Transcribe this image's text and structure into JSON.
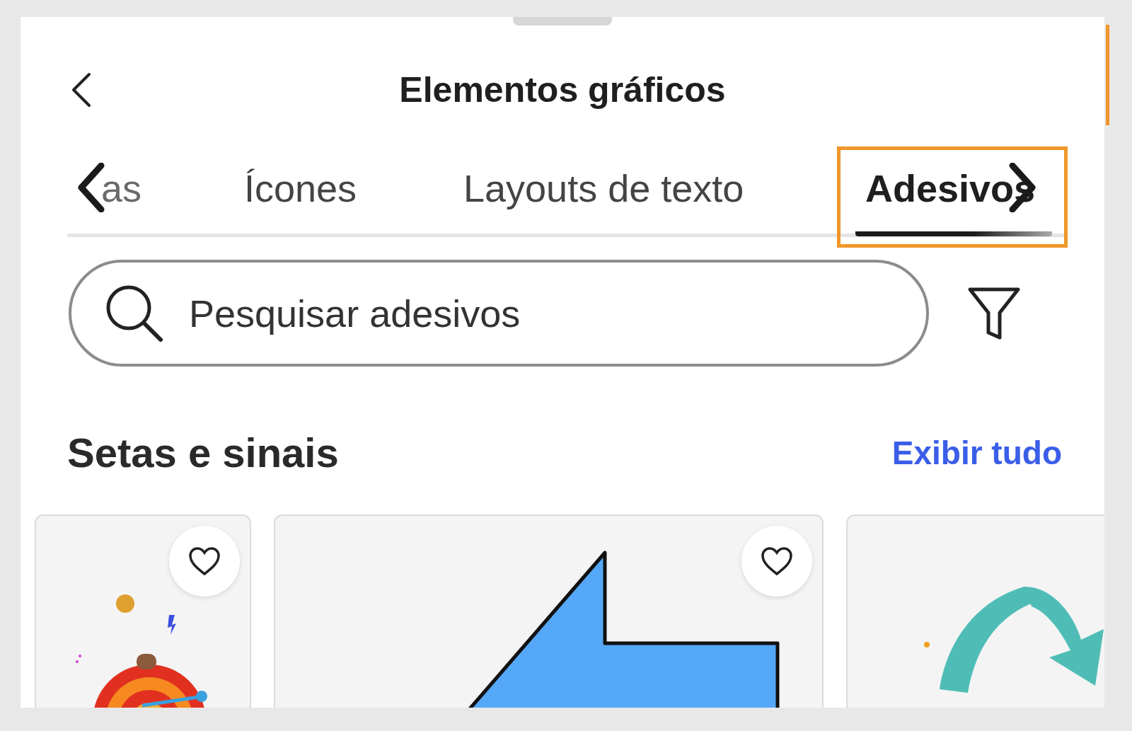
{
  "header": {
    "title": "Elementos gráficos"
  },
  "tabs": [
    {
      "label": "as",
      "selected": false
    },
    {
      "label": "Ícones",
      "selected": false
    },
    {
      "label": "Layouts de texto",
      "selected": false
    },
    {
      "label": "Adesivos",
      "selected": true
    }
  ],
  "search": {
    "placeholder": "Pesquisar adesivos"
  },
  "section": {
    "title": "Setas e sinais",
    "link": "Exibir tudo"
  },
  "stickers": [
    {
      "kind": "target",
      "favorite": false
    },
    {
      "kind": "arrow",
      "favorite": false
    },
    {
      "kind": "curve"
    }
  ]
}
